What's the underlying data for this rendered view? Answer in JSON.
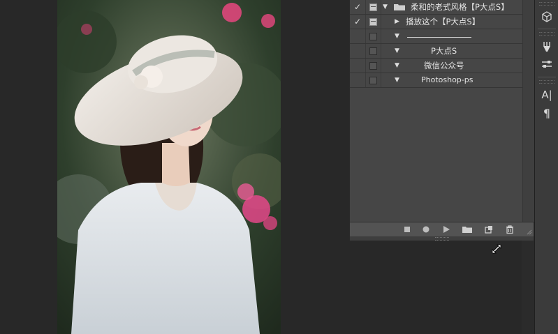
{
  "actions": {
    "set": {
      "checked": "✓",
      "name": "柔和的老式风格【P大点S】"
    },
    "items": [
      {
        "checked": "✓",
        "name": "播放这个【P大点S】",
        "expand": "▶",
        "dialog": true
      },
      {
        "checked": "",
        "name": "",
        "expand": "▼",
        "dialog": false
      },
      {
        "checked": "",
        "name": "P大点S",
        "expand": "▼",
        "dialog": false
      },
      {
        "checked": "",
        "name": "微信公众号",
        "expand": "▼",
        "dialog": false
      },
      {
        "checked": "",
        "name": "Photoshop-ps",
        "expand": "▼",
        "dialog": false
      }
    ],
    "footer_buttons": [
      "stop-icon",
      "record-icon",
      "play-icon",
      "new-set-icon",
      "new-action-icon",
      "delete-icon"
    ]
  },
  "toolstrip": {
    "items": [
      "3d-icon",
      "brush-icon",
      "adjust-icon",
      "character-icon",
      "paragraph-icon"
    ],
    "character_glyph": "A|",
    "paragraph_glyph": "¶"
  },
  "colors": {
    "panel_bg": "#464646",
    "canvas_bg": "#282828",
    "accent_pink": "#e8477f"
  }
}
